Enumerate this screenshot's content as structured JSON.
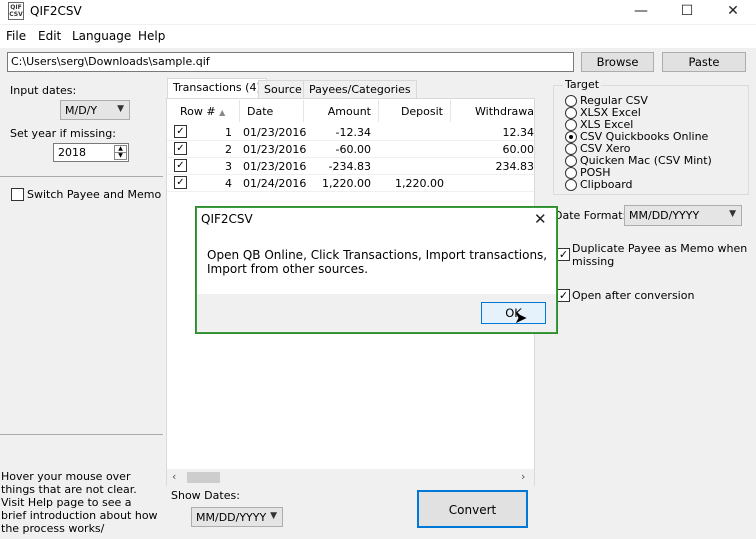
{
  "window": {
    "title": "QIF2CSV",
    "icon_text": "QIF CSV",
    "controls": {
      "minimize": "—",
      "maximize": "☐",
      "close": "✕"
    }
  },
  "menu": [
    "File",
    "Edit",
    "Language",
    "Help"
  ],
  "path": {
    "value": "C:\\Users\\serg\\Downloads\\sample.qif"
  },
  "buttons": {
    "browse": "Browse",
    "paste": "Paste",
    "convert": "Convert"
  },
  "left": {
    "input_dates_label": "Input dates:",
    "input_dates_value": "M/D/Y",
    "year_label": "Set year if missing:",
    "year_value": "2018",
    "switch_label": "Switch Payee and Memo",
    "switch_checked": false,
    "help_text": "Hover your mouse over things that are not clear. Visit Help page to see a brief introduction about how the process works/"
  },
  "tabs": [
    "Transactions (4)",
    "Source",
    "Payees/Categories"
  ],
  "table": {
    "columns": [
      "Row #",
      "Date",
      "Amount",
      "Deposit",
      "Withdrawa"
    ],
    "rows": [
      {
        "checked": true,
        "row": "1",
        "date": "01/23/2016",
        "amount": "-12.34",
        "deposit": "",
        "withdrawal": "12.34"
      },
      {
        "checked": true,
        "row": "2",
        "date": "01/23/2016",
        "amount": "-60.00",
        "deposit": "",
        "withdrawal": "60.00"
      },
      {
        "checked": true,
        "row": "3",
        "date": "01/23/2016",
        "amount": "-234.83",
        "deposit": "",
        "withdrawal": "234.83"
      },
      {
        "checked": true,
        "row": "4",
        "date": "01/24/2016",
        "amount": "1,220.00",
        "deposit": "1,220.00",
        "withdrawal": ""
      }
    ]
  },
  "show_dates": {
    "label": "Show Dates:",
    "value": "MM/DD/YYYY"
  },
  "target": {
    "title": "Target",
    "options": [
      "Regular CSV",
      "XLSX Excel",
      "XLS Excel",
      "CSV Quickbooks Online",
      "CSV Xero",
      "Quicken Mac (CSV Mint)",
      "POSH",
      "Clipboard"
    ],
    "selected": "CSV Quickbooks Online"
  },
  "date_format": {
    "label": "Date Format:",
    "value": "MM/DD/YYYY"
  },
  "options": {
    "duplicate_payee": "Duplicate Payee as Memo when missing",
    "duplicate_payee_checked": true,
    "open_after": "Open after conversion",
    "open_after_checked": true
  },
  "dialog": {
    "title": "QIF2CSV",
    "message": "Open QB Online, Click Transactions, Import transactions, Import from other sources.",
    "ok": "OK"
  },
  "colors": {
    "dialog_border": "#3c9b3c",
    "button_face": "#e1e1e1"
  }
}
